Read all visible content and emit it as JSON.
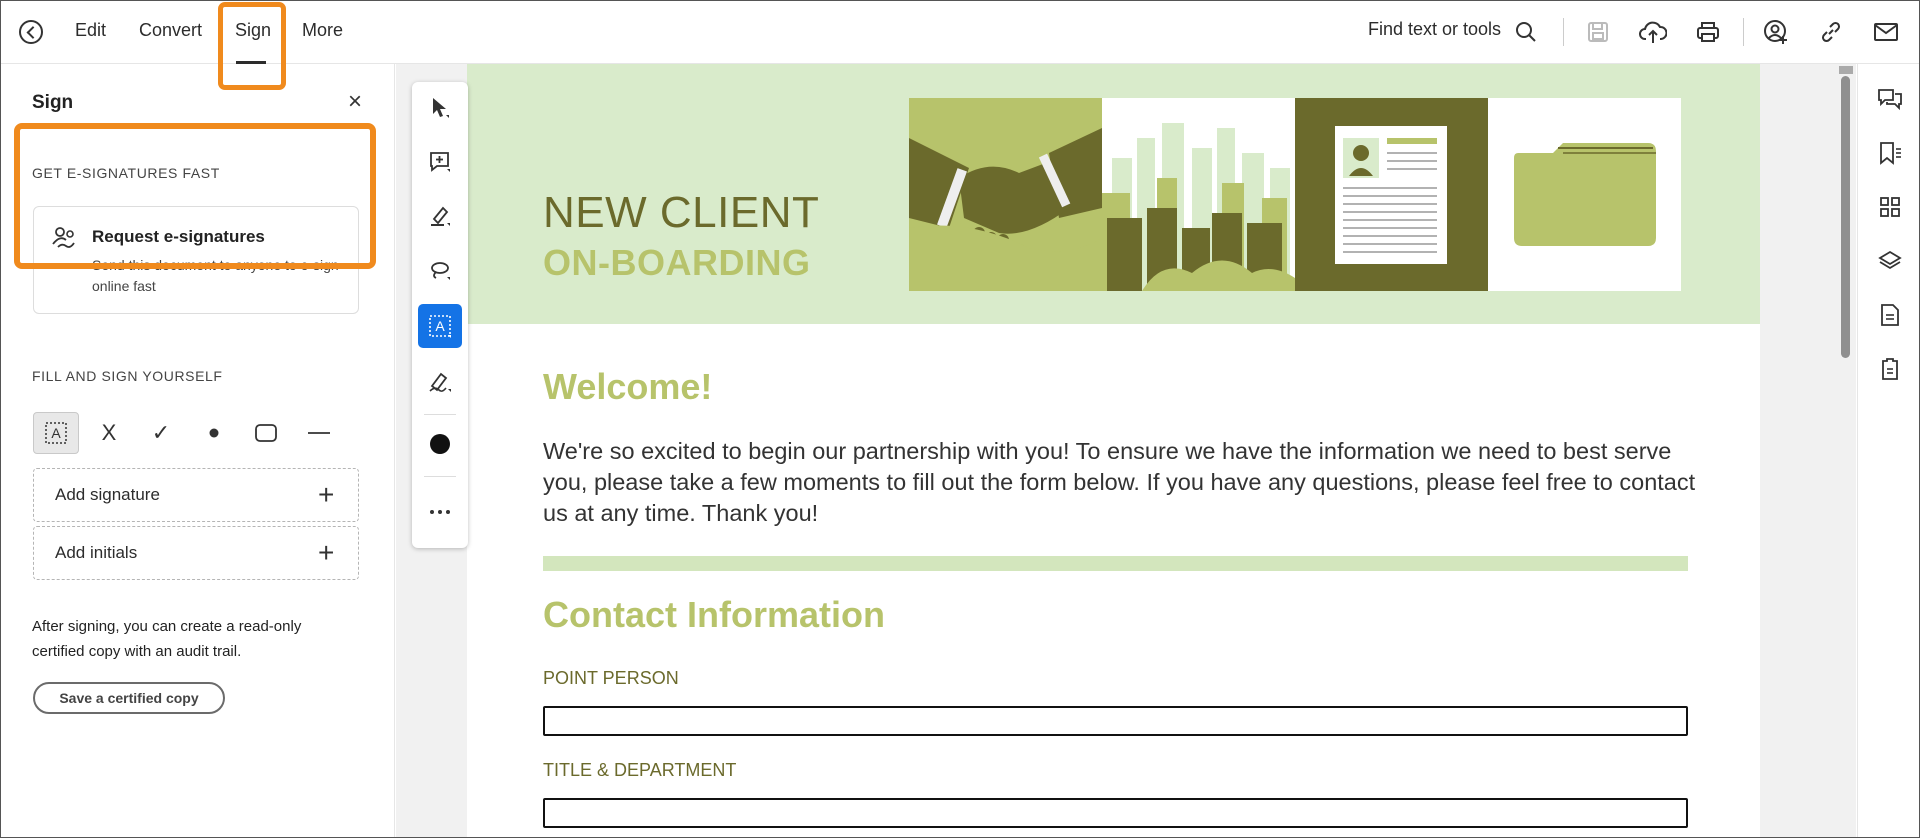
{
  "topbar": {
    "nav": [
      "Edit",
      "Convert",
      "Sign",
      "More"
    ],
    "search_label": "Find text or tools"
  },
  "sign_panel": {
    "title": "Sign",
    "section_esign": "GET E-SIGNATURES FAST",
    "request_title": "Request e-signatures",
    "request_desc": "Send this document to anyone to e-sign online fast",
    "section_fill": "FILL AND SIGN YOURSELF",
    "tools": {
      "cross": "X"
    },
    "add_signature": "Add signature",
    "add_initials": "Add initials",
    "after_text": "After signing, you can create a read-only certified copy with an audit trail.",
    "certified_button": "Save a certified copy"
  },
  "document": {
    "banner_line1": "NEW CLIENT",
    "banner_line2": "ON-BOARDING",
    "welcome_heading": "Welcome!",
    "welcome_body": "We're so excited to begin our partnership with you! To ensure we have the information we need to best serve you, please take a few moments to fill out the form below. If you have any questions, please feel free to contact us at any time. Thank you!",
    "contact_heading": "Contact Information",
    "fields": [
      "POINT PERSON",
      "TITLE & DEPARTMENT"
    ]
  },
  "colors": {
    "highlight": "#f08a1d",
    "accent_blue": "#1473e6",
    "brand_olive": "#6b6a2c",
    "brand_green": "#b7c36b",
    "banner_bg": "#d9ebcb"
  },
  "icons": {
    "topbar": [
      "home-icon",
      "search-icon",
      "save-icon",
      "upload-cloud-icon",
      "print-icon",
      "add-user-icon",
      "link-icon",
      "mail-icon"
    ],
    "quick_tools": [
      "select-cursor-icon",
      "add-comment-icon",
      "highlight-pen-icon",
      "draw-lasso-icon",
      "add-text-icon",
      "sign-pen-icon",
      "color-dot-icon",
      "more-icon"
    ],
    "right_rail": [
      "comments-icon",
      "bookmarks-icon",
      "thumbnails-icon",
      "layers-icon",
      "document-icon",
      "file-info-icon"
    ]
  }
}
